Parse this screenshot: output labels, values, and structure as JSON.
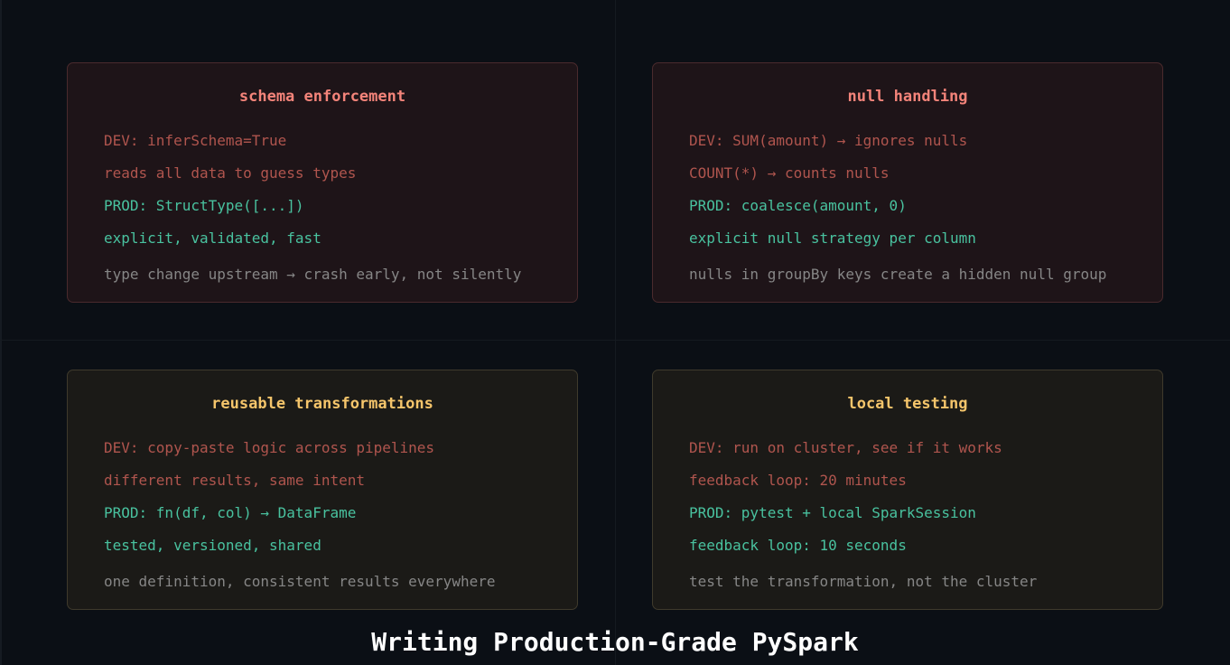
{
  "title": "Writing Production-Grade PySpark",
  "cards": [
    {
      "title": "schema enforcement",
      "dev": "DEV: inferSchema=True",
      "dev_detail": "reads all data to guess types",
      "prod": "PROD: StructType([...])",
      "prod_detail": "explicit, validated, fast",
      "note": "type change upstream → crash early, not silently"
    },
    {
      "title": "null handling",
      "dev": "DEV: SUM(amount) → ignores nulls",
      "dev_detail": "COUNT(*) → counts nulls",
      "prod": "PROD: coalesce(amount, 0)",
      "prod_detail": "explicit null strategy per column",
      "note": "nulls in groupBy keys create a hidden null group"
    },
    {
      "title": "reusable transformations",
      "dev": "DEV: copy-paste logic across pipelines",
      "dev_detail": "different results, same intent",
      "prod": "PROD: fn(df, col) → DataFrame",
      "prod_detail": "tested, versioned, shared",
      "note": "one definition, consistent results everywhere"
    },
    {
      "title": "local testing",
      "dev": "DEV: run on cluster, see if it works",
      "dev_detail": "feedback loop: 20 minutes",
      "prod": "PROD: pytest + local SparkSession",
      "prod_detail": "feedback loop: 10 seconds",
      "note": "test the transformation, not the cluster"
    }
  ],
  "colors": {
    "background": "#0b0f15",
    "top_card_title": "#f4847a",
    "bottom_card_title": "#f5c56b",
    "dev_text": "#b0554e",
    "prod_text": "#49c29f",
    "note_text": "#868686"
  }
}
